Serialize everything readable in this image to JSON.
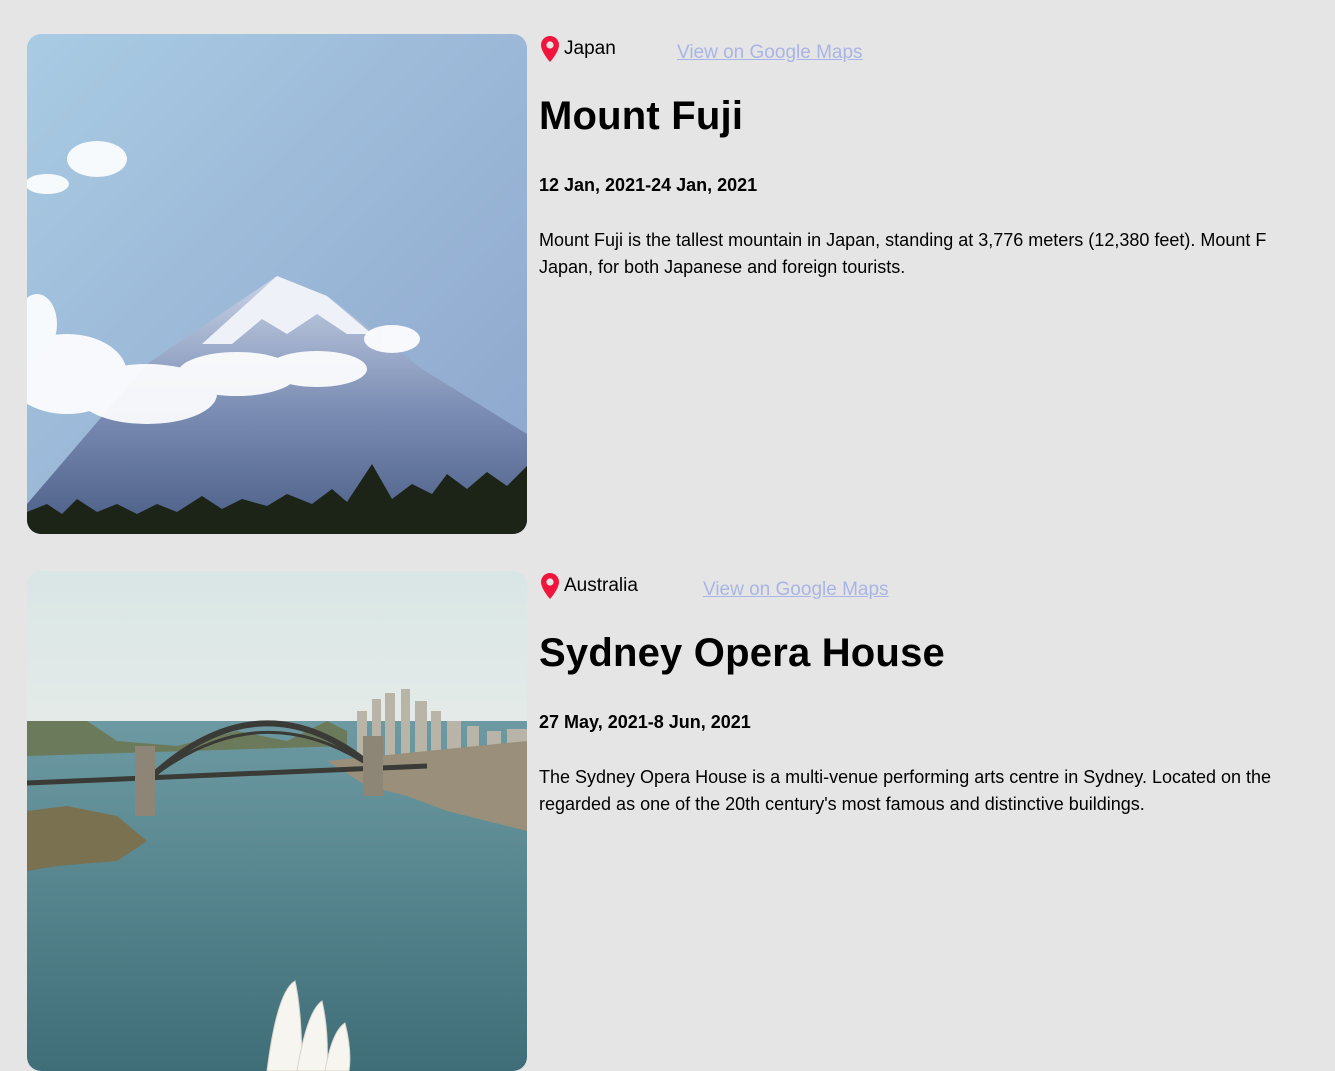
{
  "entries": [
    {
      "country": "Japan",
      "maps_link": "View on Google Maps",
      "title": "Mount Fuji",
      "dates": "12 Jan, 2021-24 Jan, 2021",
      "description_lines": [
        "Mount Fuji is the tallest mountain in Japan, standing at 3,776 meters (12,380 feet). Mount F",
        "Japan, for both Japanese and foreign tourists."
      ],
      "photo_icon": "mount-fuji-photo"
    },
    {
      "country": "Australia",
      "maps_link": "View on Google Maps",
      "title": "Sydney Opera House",
      "dates": "27 May, 2021-8 Jun, 2021",
      "description_lines": [
        "The Sydney Opera House is a multi-venue performing arts centre in Sydney. Located on the",
        "regarded as one of the 20th century's most famous and distinctive buildings."
      ],
      "photo_icon": "sydney-harbour-photo"
    }
  ],
  "colors": {
    "background": "#e5e5e5",
    "pin": "#f0153c",
    "link": "#a9b5e4",
    "text": "#000000"
  },
  "icons": {
    "location": "map-pin-icon"
  }
}
